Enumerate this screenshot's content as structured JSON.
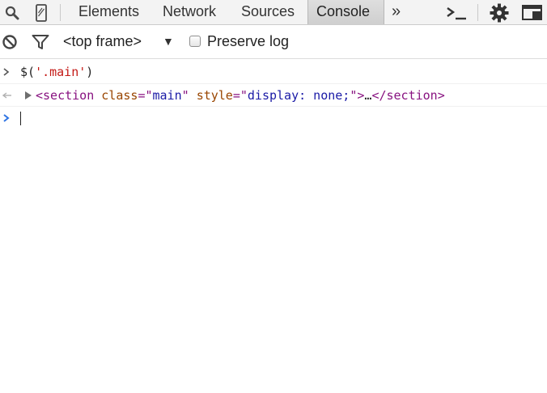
{
  "tabs": [
    {
      "label": "Elements",
      "active": false
    },
    {
      "label": "Network",
      "active": false
    },
    {
      "label": "Sources",
      "active": false
    },
    {
      "label": "Console",
      "active": true
    }
  ],
  "more_tabs": "»",
  "toolbar": {
    "frame_select": "<top frame>",
    "preserve_log_label": "Preserve log",
    "preserve_log_checked": false
  },
  "console": {
    "input_command": {
      "fn": "$(",
      "arg": "'.main'",
      "close": ")"
    },
    "result": {
      "open_bracket": "<",
      "tag": "section",
      "attr1_name": "class",
      "eq1": "=\"",
      "attr1_value": "main",
      "q1": "\"",
      "attr2_name": "style",
      "eq2": "=\"",
      "attr2_value": "display: none;",
      "q2": "\"",
      "close_bracket": ">",
      "ellipsis": "…",
      "close_tag": "</section>"
    }
  },
  "colors": {
    "tabbar_bg": "#f3f3f3",
    "prompt_blue": "#2f74e3",
    "tag_purple": "#881280",
    "attr_brown": "#994500",
    "value_blue": "#1a1aa6",
    "string_red": "#c41a16"
  },
  "icons": [
    "search-icon",
    "device-mode-icon",
    "drawer-toggle-icon",
    "settings-gear-icon",
    "dock-side-icon",
    "clear-console-icon",
    "filter-icon",
    "disclosure-triangle-icon",
    "input-prompt-icon",
    "result-arrow-icon"
  ]
}
